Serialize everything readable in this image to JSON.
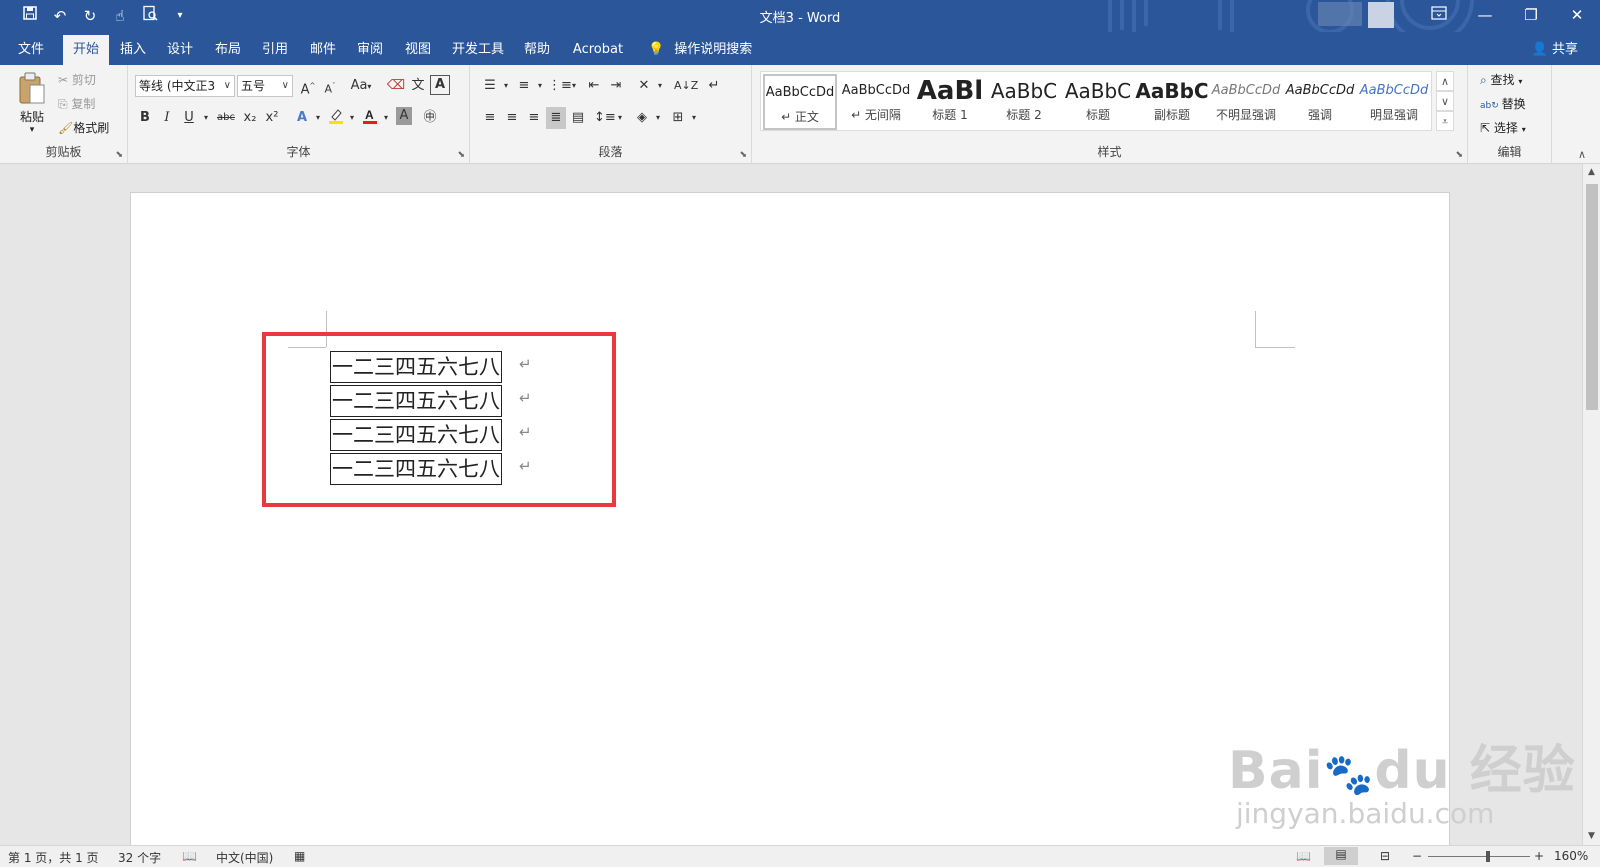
{
  "window": {
    "title": "文档3 - Word",
    "accent": "#2b579a",
    "controls": [
      "ribbon-display-icon",
      "minimize-icon",
      "restore-icon",
      "close-icon"
    ]
  },
  "quick_access": [
    "save-icon",
    "undo-icon",
    "redo-icon",
    "touch-mode-icon",
    "print-preview-icon",
    "customize-icon"
  ],
  "tabs": [
    "文件",
    "开始",
    "插入",
    "设计",
    "布局",
    "引用",
    "邮件",
    "审阅",
    "视图",
    "开发工具",
    "帮助",
    "Acrobat"
  ],
  "active_tab": "开始",
  "tell_me": "操作说明搜索",
  "share": "共享",
  "clipboard": {
    "label": "剪贴板",
    "paste": "粘贴",
    "cut": "剪切",
    "copy": "复制",
    "format_painter": "格式刷"
  },
  "font": {
    "label": "字体",
    "font_name": "等线 (中文正3",
    "font_size": "五号",
    "bold": "B",
    "italic": "I",
    "underline": "U",
    "strike": "abc",
    "subscript": "x₂",
    "superscript": "x²",
    "change_case": "Aa",
    "font_color": "#e02020",
    "highlight_color": "#f5e300"
  },
  "paragraph": {
    "label": "段落"
  },
  "styles": {
    "label": "样式",
    "items": [
      {
        "sample": "AaBbCcDd",
        "name": "↵ 正文"
      },
      {
        "sample": "AaBbCcDd",
        "name": "↵ 无间隔"
      },
      {
        "sample": "AaBl",
        "name": "标题 1"
      },
      {
        "sample": "AaBbC",
        "name": "标题 2"
      },
      {
        "sample": "AaBbC",
        "name": "标题"
      },
      {
        "sample": "AaBbC",
        "name": "副标题"
      },
      {
        "sample": "AaBbCcDd",
        "name": "不明显强调"
      },
      {
        "sample": "AaBbCcDd",
        "name": "强调"
      },
      {
        "sample": "AaBbCcDd",
        "name": "明显强调"
      }
    ]
  },
  "editing": {
    "label": "编辑",
    "find": "查找",
    "replace": "替换",
    "select": "选择"
  },
  "document": {
    "lines": [
      "一二三四五六七八",
      "一二三四五六七八",
      "一二三四五六七八",
      "一二三四五六七八"
    ],
    "paragraph_mark": "↵",
    "highlight_color": "#e8393f"
  },
  "status": {
    "page": "第 1 页，共 1 页",
    "words": "32 个字",
    "language": "中文(中国)",
    "zoom": "160%",
    "zoom_minus": "−",
    "zoom_plus": "+"
  },
  "watermark": {
    "brand": "Bai du 经验",
    "url": "jingyan.baidu.com"
  }
}
